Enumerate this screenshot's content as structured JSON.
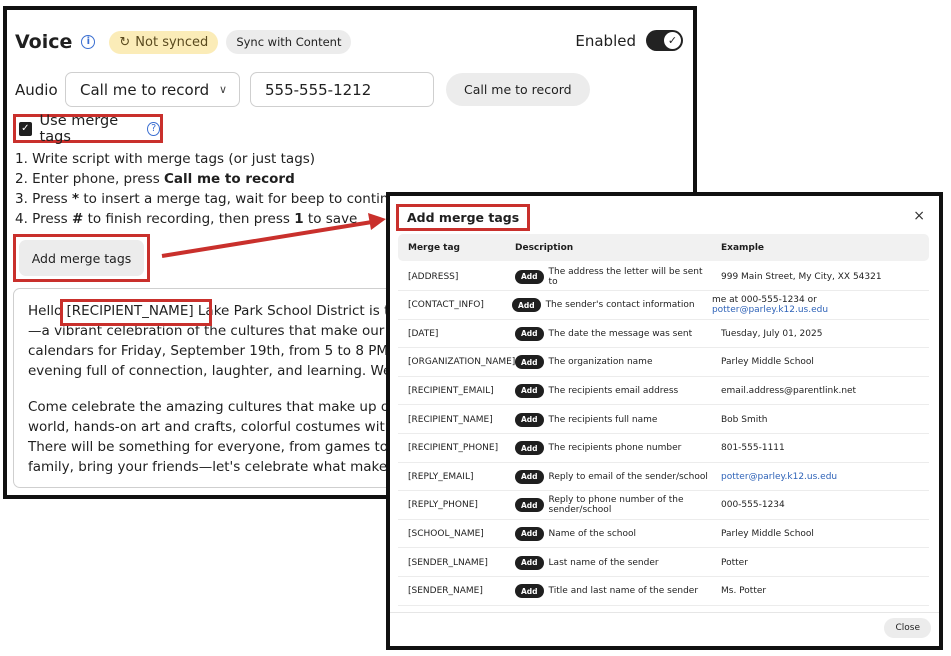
{
  "voice": {
    "title": "Voice",
    "info_glyph": "i",
    "sync_status": "Not synced",
    "sync_button": "Sync with Content",
    "enabled_label": "Enabled",
    "audio_label": "Audio",
    "audio_mode": "Call me to record",
    "phone_value": "555-555-1212",
    "record_button": "Call me to record",
    "use_merge_tags_label": "Use merge tags",
    "instructions": {
      "line1": "1. Write script with merge tags (or just tags)",
      "line2_prefix": "2. Enter phone, press ",
      "line2_bold": "Call me to record",
      "line3_prefix": "3. Press ",
      "line3_bold": "*",
      "line3_suffix": " to insert a merge tag, wait for beep to continue",
      "line4_prefix": "4. Press ",
      "line4_bold1": "#",
      "line4_mid": " to finish recording, then press ",
      "line4_bold2": "1",
      "line4_suffix": " to save"
    },
    "add_merge_tags_button": "Add merge tags",
    "script": {
      "para1": "Hello [RECIPIENT_NAME] Lake Park School District is thrilled to invite you to our annual Culture Fair—a vibrant celebration of the cultures that make our school community so special. Mark your calendars for Friday, September 19th, from 5 to 8 PM in the school auditorium. It's going to be an evening full of connection, laughter, and learning. We can't wait to see you there!",
      "para2": "Come celebrate the amazing cultures that make up our school with delicious food from around the world, hands-on art and crafts, colorful costumes with performances by our talented students. There will be something for everyone, from games to surprises for the whole family. So bring your family, bring your friends—let's celebrate what makes us who we are!"
    },
    "colors": {
      "highlight": "#c9302c",
      "badge_bg": "#fbecb8"
    }
  },
  "modal": {
    "title": "Add merge tags",
    "close_glyph": "×",
    "columns": {
      "tag": "Merge tag",
      "description": "Description",
      "example": "Example"
    },
    "add_label": "Add",
    "rows": [
      {
        "tag": "[ADDRESS]",
        "description": "The address the letter will be sent to",
        "example": "999 Main Street, My City, XX 54321"
      },
      {
        "tag": "[CONTACT_INFO]",
        "description": "The sender's contact information",
        "example": "me at 000-555-1234 or ",
        "example_link": "potter@parley.k12.us.edu"
      },
      {
        "tag": "[DATE]",
        "description": "The date the message was sent",
        "example": "Tuesday, July 01, 2025"
      },
      {
        "tag": "[ORGANIZATION_NAME]",
        "description": "The organization name",
        "example": "Parley Middle School"
      },
      {
        "tag": "[RECIPIENT_EMAIL]",
        "description": "The recipients email address",
        "example": "email.address@parentlink.net"
      },
      {
        "tag": "[RECIPIENT_NAME]",
        "description": "The recipients full name",
        "example": "Bob Smith"
      },
      {
        "tag": "[RECIPIENT_PHONE]",
        "description": "The recipients phone number",
        "example": "801-555-1111"
      },
      {
        "tag": "[REPLY_EMAIL]",
        "description": "Reply to email of the sender/school",
        "example": "",
        "example_link": "potter@parley.k12.us.edu"
      },
      {
        "tag": "[REPLY_PHONE]",
        "description": "Reply to phone number of the sender/school",
        "example": "000-555-1234"
      },
      {
        "tag": "[SCHOOL_NAME]",
        "description": "Name of the school",
        "example": "Parley Middle School"
      },
      {
        "tag": "[SENDER_LNAME]",
        "description": "Last name of the sender",
        "example": "Potter"
      },
      {
        "tag": "[SENDER_NAME]",
        "description": "Title and last name of the sender",
        "example": "Ms. Potter"
      }
    ],
    "close_button": "Close"
  }
}
